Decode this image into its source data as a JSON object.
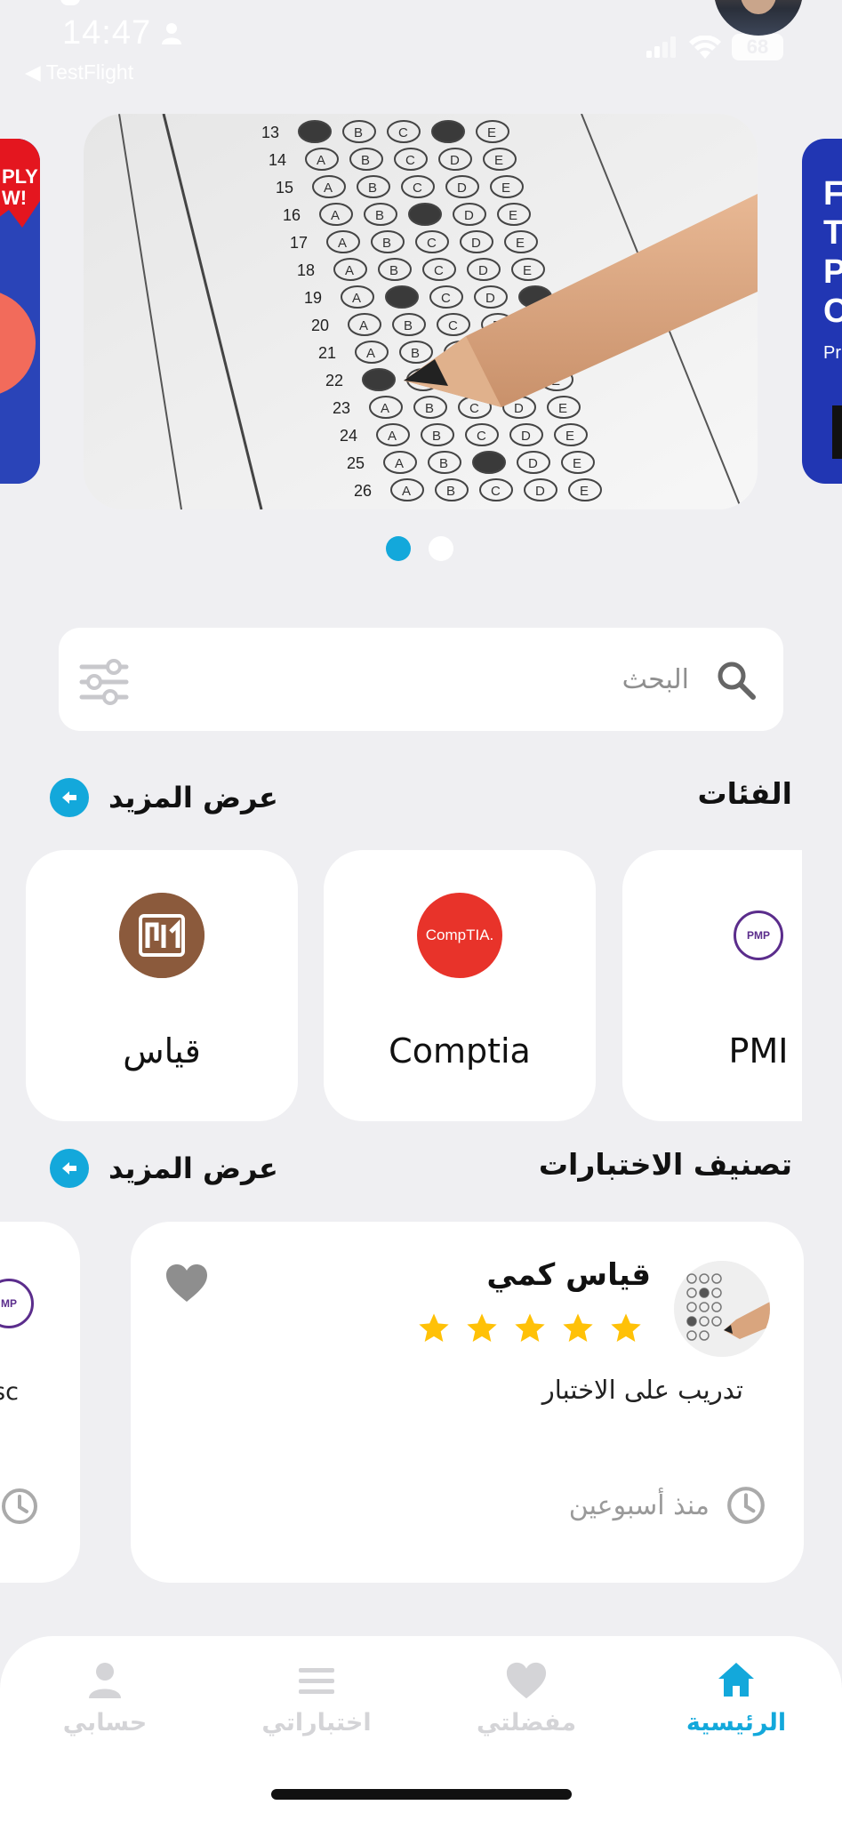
{
  "status_bar": {
    "time": "14:47",
    "back_label": "◀ TestFlight",
    "battery": "68"
  },
  "carousel": {
    "next_banner_letters": "F\nT\nP\nC",
    "next_banner_sub": "Pr",
    "prev_banner_sticker": "PLY\nW!",
    "active_index": 0,
    "count": 2
  },
  "search": {
    "placeholder": "البحث"
  },
  "categories_section": {
    "title": "الفئات",
    "more_label": "عرض المزيد",
    "items": [
      {
        "label": "قياس",
        "logo": "qiyas-logo"
      },
      {
        "label": "Comptia",
        "logo": "comptia-logo",
        "logo_text": "CompTIA."
      },
      {
        "label": "PMI",
        "logo": "pmp-logo",
        "logo_text": "PMP"
      }
    ]
  },
  "exams_section": {
    "title": "تصنيف الاختبارات",
    "more_label": "عرض المزيد",
    "items": [
      {
        "title": "قياس كمي",
        "rating": 5,
        "subtitle": "تدريب على الاختبار",
        "time": "منذ أسبوعين"
      }
    ],
    "partial_item": {
      "subtitle_fragment": "sc",
      "logo_text": "MP"
    }
  },
  "bottom_nav": {
    "items": [
      {
        "label": "حسابي",
        "icon": "person-icon",
        "active": false
      },
      {
        "label": "اختباراتي",
        "icon": "list-icon",
        "active": false
      },
      {
        "label": "مفضلتي",
        "icon": "heart-icon",
        "active": false
      },
      {
        "label": "الرئيسية",
        "icon": "home-icon",
        "active": true
      }
    ]
  },
  "colors": {
    "accent": "#13a8db",
    "background": "#efeff2",
    "star": "#ffc107",
    "inactive_nav": "#d4d4d7",
    "comptia_red": "#e8332a",
    "qiyas_brown": "#8b5a3c",
    "pmp_purple": "#5b2d8c"
  }
}
